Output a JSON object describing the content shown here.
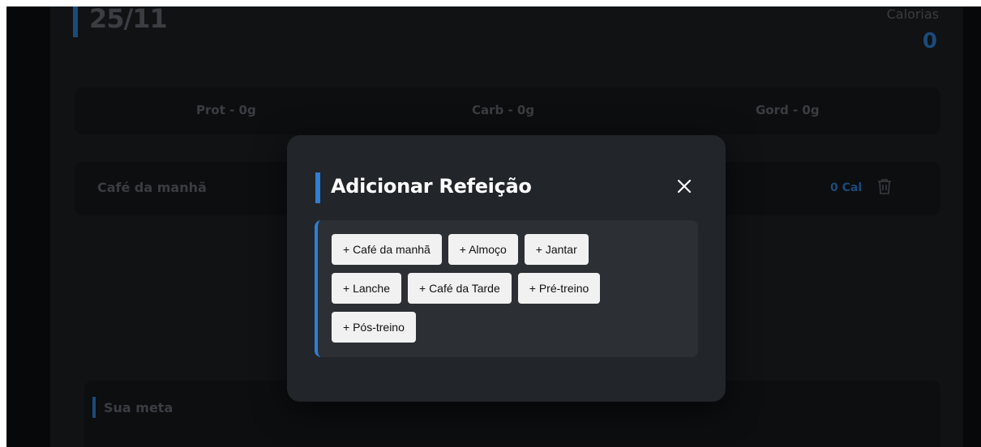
{
  "header": {
    "date": "25/11",
    "calories_label": "Calorias",
    "calories_value": "0"
  },
  "macros": {
    "protein": "Prot - 0g",
    "carbs": "Carb - 0g",
    "fat": "Gord - 0g"
  },
  "meal": {
    "name": "Café da manhã",
    "calories": "0 Cal"
  },
  "goal": {
    "title": "Sua meta"
  },
  "modal": {
    "title": "Adicionar Refeição",
    "options": [
      "+ Café da manhã",
      "+ Almoço",
      "+ Jantar",
      "+ Lanche",
      "+ Café da Tarde",
      "+ Pré-treino",
      "+ Pós-treino"
    ]
  },
  "colors": {
    "accent": "#2f7fd4",
    "modal_bg": "#222529",
    "panel_bg": "#2c2f34",
    "chip_bg": "#f1f1f1"
  },
  "icons": {
    "close": "close-icon",
    "delete": "trash-icon"
  }
}
